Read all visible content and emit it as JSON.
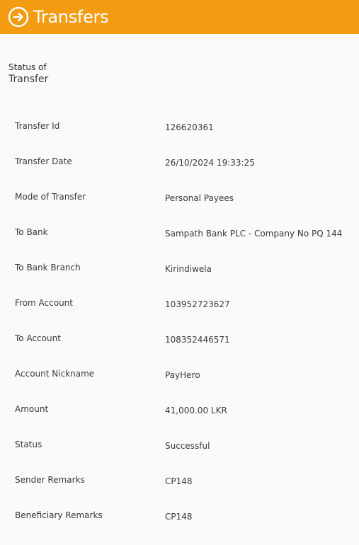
{
  "header": {
    "title": "Transfers",
    "icon": "arrow-right-circle-icon",
    "background_color": "#f39c12"
  },
  "status_heading": {
    "line1": "Status of",
    "line2": "Transfer"
  },
  "details": [
    {
      "label": "Transfer Id",
      "value": "126620361"
    },
    {
      "label": "Transfer Date",
      "value": "26/10/2024 19:33:25"
    },
    {
      "label": "Mode of Transfer",
      "value": "Personal Payees"
    },
    {
      "label": "To Bank",
      "value": "Sampath Bank PLC - Company No PQ 144"
    },
    {
      "label": "To Bank Branch",
      "value": "Kirindiwela"
    },
    {
      "label": "From Account",
      "value": "103952723627"
    },
    {
      "label": "To Account",
      "value": "108352446571"
    },
    {
      "label": "Account Nickname",
      "value": "PayHero"
    },
    {
      "label": "Amount",
      "value": "41,000.00 LKR"
    },
    {
      "label": "Status",
      "value": "Successful"
    },
    {
      "label": "Sender Remarks",
      "value": "CP148"
    },
    {
      "label": "Beneficiary Remarks",
      "value": "CP148"
    }
  ]
}
